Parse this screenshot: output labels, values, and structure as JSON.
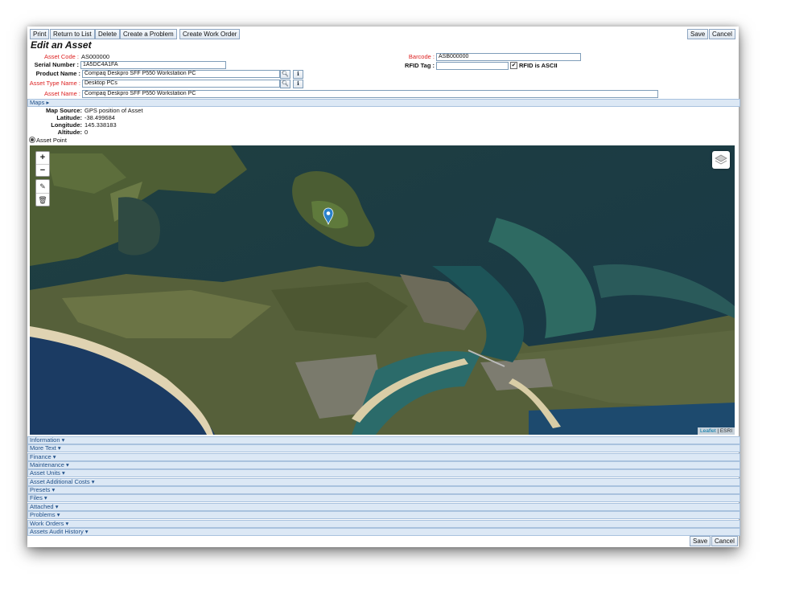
{
  "toolbar": {
    "print": "Print",
    "return_to_list": "Return to List",
    "delete": "Delete",
    "create_problem": "Create a Problem",
    "create_work_order": "Create Work Order",
    "save": "Save",
    "cancel": "Cancel"
  },
  "page_title": "Edit an Asset",
  "fields": {
    "asset_code_label": "Asset Code :",
    "asset_code_value": "AS000000",
    "serial_number_label": "Serial Number :",
    "serial_number_value": "1A5DC4A1FA",
    "product_name_label": "Product Name :",
    "product_name_value": "Compaq Deskpro SFF P550 Workstation PC",
    "asset_type_label": "Asset Type Name :",
    "asset_type_value": "Desktop PCs",
    "asset_name_label": "Asset Name :",
    "asset_name_value": "Compaq Deskpro SFF P550 Workstation PC",
    "barcode_label": "Barcode :",
    "barcode_value": "ASB000000",
    "rfid_tag_label": "RFID Tag :",
    "rfid_tag_value": "",
    "rfid_ascii_label": "RFID is ASCII",
    "rfid_ascii_checked": true
  },
  "maps": {
    "header": "Maps",
    "map_source_label": "Map Source:",
    "map_source_value": "GPS position of Asset",
    "latitude_label": "Latitude:",
    "latitude_value": "-38.499684",
    "longitude_label": "Longitude:",
    "longitude_value": "145.338183",
    "altitude_label": "Altitude:",
    "altitude_value": "0",
    "asset_point_label": "Asset Point",
    "zoom_in": "+",
    "zoom_out": "−",
    "attribution_leaflet": "Leaflet",
    "attribution_sep": " | ",
    "attribution_esri": "ESRI"
  },
  "sections": [
    "Information",
    "More Text",
    "Finance",
    "Maintenance",
    "Asset Units",
    "Asset Additional Costs",
    "Presets",
    "Files",
    "Attached",
    "Problems",
    "Work Orders",
    "Assets Audit History"
  ],
  "colors": {
    "required_label": "#dd2222",
    "section_bg": "#dce8f5",
    "marker": "#2a81cb"
  }
}
